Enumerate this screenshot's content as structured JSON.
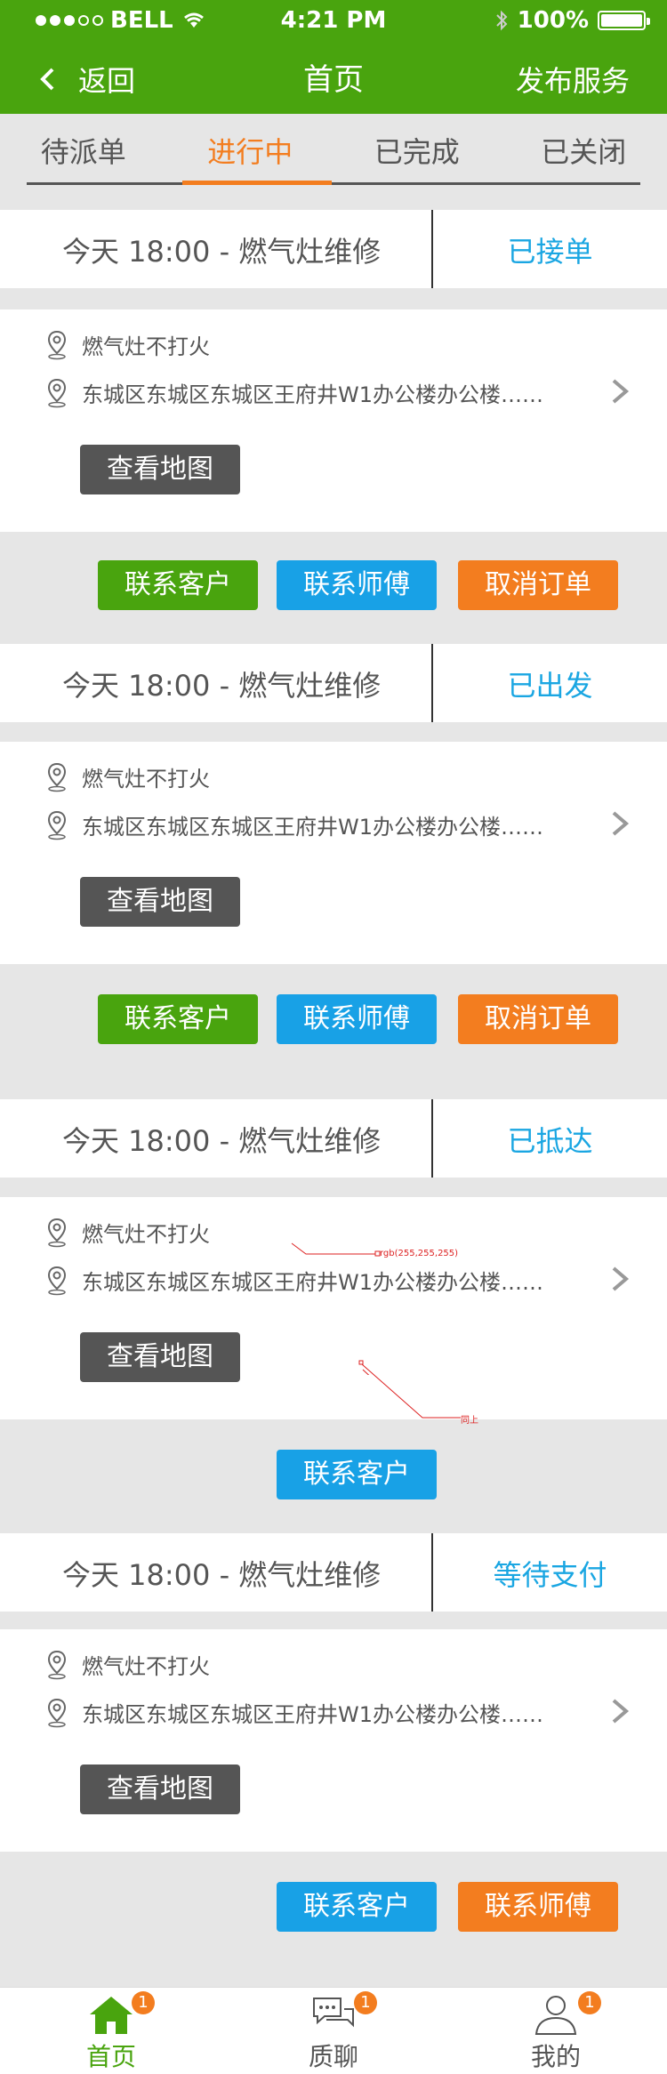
{
  "status_bar": {
    "carrier": "BELL",
    "time": "4:21 PM",
    "battery": "100%"
  },
  "nav": {
    "back_label": "返回",
    "title": "首页",
    "publish_label": "发布服务"
  },
  "tabs": [
    {
      "label": "待派单"
    },
    {
      "label": "进行中"
    },
    {
      "label": "已完成"
    },
    {
      "label": "已关闭"
    }
  ],
  "orders": [
    {
      "when": "今天  18:00  -  燃气灶维修",
      "state": "已接单",
      "issue": "燃气灶不打火",
      "address": "东城区东城区东城区王府井W1办公楼办公楼……",
      "map_label": "查看地图",
      "buttons": [
        "联系客户",
        "联系师傅",
        "取消订单"
      ]
    },
    {
      "when": "今天  18:00  -  燃气灶维修",
      "state": "已出发",
      "issue": "燃气灶不打火",
      "address": "东城区东城区东城区王府井W1办公楼办公楼……",
      "map_label": "查看地图",
      "buttons": [
        "联系客户",
        "联系师傅",
        "取消订单"
      ]
    },
    {
      "when": "今天  18:00  -  燃气灶维修",
      "state": "已抵达",
      "issue": "燃气灶不打火",
      "address": "东城区东城区东城区王府井W1办公楼办公楼……",
      "map_label": "查看地图",
      "buttons": [
        "联系客户"
      ]
    },
    {
      "when": "今天  18:00  -  燃气灶维修",
      "state": "等待支付",
      "issue": "燃气灶不打火",
      "address": "东城区东城区东城区王府井W1办公楼办公楼……",
      "map_label": "查看地图",
      "buttons": [
        "联系客户",
        "联系师傅"
      ]
    }
  ],
  "annotations": {
    "color_note": "rgb(255,255,255)",
    "same_note": "同上"
  },
  "bottom_tabs": [
    {
      "label": "首页",
      "badge": "1"
    },
    {
      "label": "质聊",
      "badge": "1"
    },
    {
      "label": "我的",
      "badge": "1"
    }
  ],
  "colors": {
    "brand_green": "#49a40e",
    "accent_orange": "#f37d1f",
    "link_blue": "#1aa6e2"
  }
}
